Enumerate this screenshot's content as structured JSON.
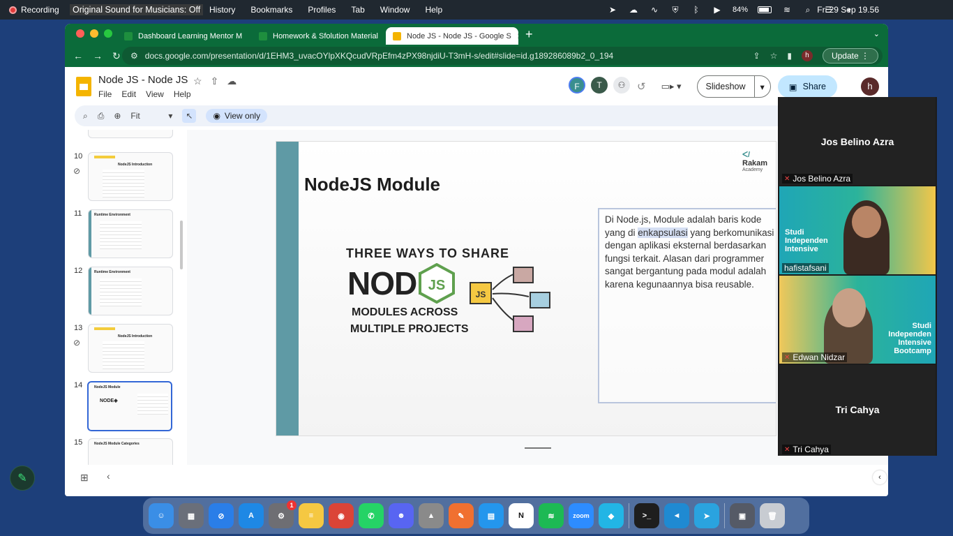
{
  "menubar": {
    "recording": "Recording",
    "original_sound": "Original Sound for Musicians: Off",
    "menus": [
      "History",
      "Bookmarks",
      "Profiles",
      "Tab",
      "Window",
      "Help"
    ],
    "battery": "84%",
    "clock": "Fri 29 Sep  19.56"
  },
  "browser": {
    "tabs": [
      {
        "label": "Dashboard Learning Mentor M",
        "icon": "sheets-icon",
        "color": "#1e8e3e"
      },
      {
        "label": "Homework & Sfolution Material",
        "icon": "sheets-icon",
        "color": "#1e8e3e"
      },
      {
        "label": "Node JS - Node JS - Google S",
        "icon": "slides-icon",
        "color": "#f4b400"
      }
    ],
    "url": "docs.google.com/presentation/d/1EHM3_uvacOYlpXKQcudVRpEfm4zPX98njdiU-T3mH-s/edit#slide=id.g189286089b2_0_194",
    "update_label": "Update"
  },
  "slides": {
    "title": "Node JS - Node JS",
    "menu": [
      "File",
      "Edit",
      "View",
      "Help"
    ],
    "avatars": [
      {
        "letter": "F",
        "color": "#3a8f8f"
      },
      {
        "letter": "T",
        "color": "#3a5a4a"
      }
    ],
    "slideshow_label": "Slideshow",
    "share_label": "Share",
    "account_letter": "h",
    "zoom_label": "Fit",
    "view_only_label": "View only"
  },
  "filmstrip": [
    {
      "num": "10",
      "title": "NodeJS Introduction",
      "linked": true,
      "selected": false
    },
    {
      "num": "11",
      "title": "Runtime Environment",
      "linked": false,
      "selected": false
    },
    {
      "num": "12",
      "title": "Runtime Environment",
      "linked": false,
      "selected": false
    },
    {
      "num": "13",
      "title": "NodeJS Introduction",
      "linked": true,
      "selected": false
    },
    {
      "num": "14",
      "title": "NodeJS Module",
      "linked": false,
      "selected": true
    },
    {
      "num": "15",
      "title": "NodeJS Module Categories",
      "linked": false,
      "selected": false
    }
  ],
  "slide": {
    "title": "NodeJS Module",
    "logo": "Rakam",
    "logo_sub": "Academy",
    "text_before": "Di Node.js, Module adalah baris kode yang di ",
    "text_highlight": "enkapsulasi",
    "text_after": " yang berkomunikasi dengan aplikasi eksternal berdasarkan fungsi terkait. Alasan dari programmer sangat bergantung pada modul adalah karena kegunaannya bisa reusable.",
    "illustration": {
      "line1": "THREE WAYS TO SHARE",
      "node": "NODE",
      "js": "JS",
      "line2": "MODULES ACROSS",
      "line3": "MULTIPLE PROJECTS",
      "box": "JS"
    }
  },
  "zoom": {
    "participants": [
      {
        "name": "Jos Belino Azra",
        "video": false
      },
      {
        "name": "hafistafsani",
        "video": true,
        "banner": "Studi Independen Intensive"
      },
      {
        "name": "Edwan Nidzar",
        "video": true,
        "banner": "Studi Independen Intensive Bootcamp"
      },
      {
        "name": "Tri Cahya",
        "video": false
      }
    ]
  },
  "dock": {
    "apps": [
      {
        "name": "finder",
        "color": "#3a8ee6",
        "glyph": "☺"
      },
      {
        "name": "launchpad",
        "color": "#6a6f7a",
        "glyph": "▦"
      },
      {
        "name": "safari",
        "color": "#2a7ee8",
        "glyph": "⊘"
      },
      {
        "name": "app-store",
        "color": "#1e88e5",
        "glyph": "A"
      },
      {
        "name": "system-settings",
        "color": "#6e6e73",
        "glyph": "⚙",
        "badge": "1"
      },
      {
        "name": "notes",
        "color": "#f5c842",
        "glyph": "≡"
      },
      {
        "name": "chrome",
        "color": "#db4437",
        "glyph": "◉"
      },
      {
        "name": "whatsapp",
        "color": "#25d366",
        "glyph": "✆"
      },
      {
        "name": "discord",
        "color": "#5865f2",
        "glyph": "☻"
      },
      {
        "name": "preview",
        "color": "#8a8a8a",
        "glyph": "▲"
      },
      {
        "name": "pencil-app",
        "color": "#f07030",
        "glyph": "✎"
      },
      {
        "name": "docker",
        "color": "#2496ed",
        "glyph": "▤"
      },
      {
        "name": "notion",
        "color": "#ffffff",
        "glyph": "N"
      },
      {
        "name": "spotify",
        "color": "#1db954",
        "glyph": "≋"
      },
      {
        "name": "zoom",
        "color": "#2d8cff",
        "glyph": "zoom"
      },
      {
        "name": "mail-app",
        "color": "#22b5e5",
        "glyph": "◆"
      },
      {
        "name": "terminal",
        "color": "#1e1e1e",
        "glyph": ">_"
      },
      {
        "name": "vscode",
        "color": "#1f8ad2",
        "glyph": "◄"
      },
      {
        "name": "telegram",
        "color": "#2aa3df",
        "glyph": "➤"
      },
      {
        "name": "downloads-stack",
        "color": "#555a66",
        "glyph": "▣"
      },
      {
        "name": "trash",
        "color": "#c8ccd2",
        "glyph": "🗑"
      }
    ]
  }
}
